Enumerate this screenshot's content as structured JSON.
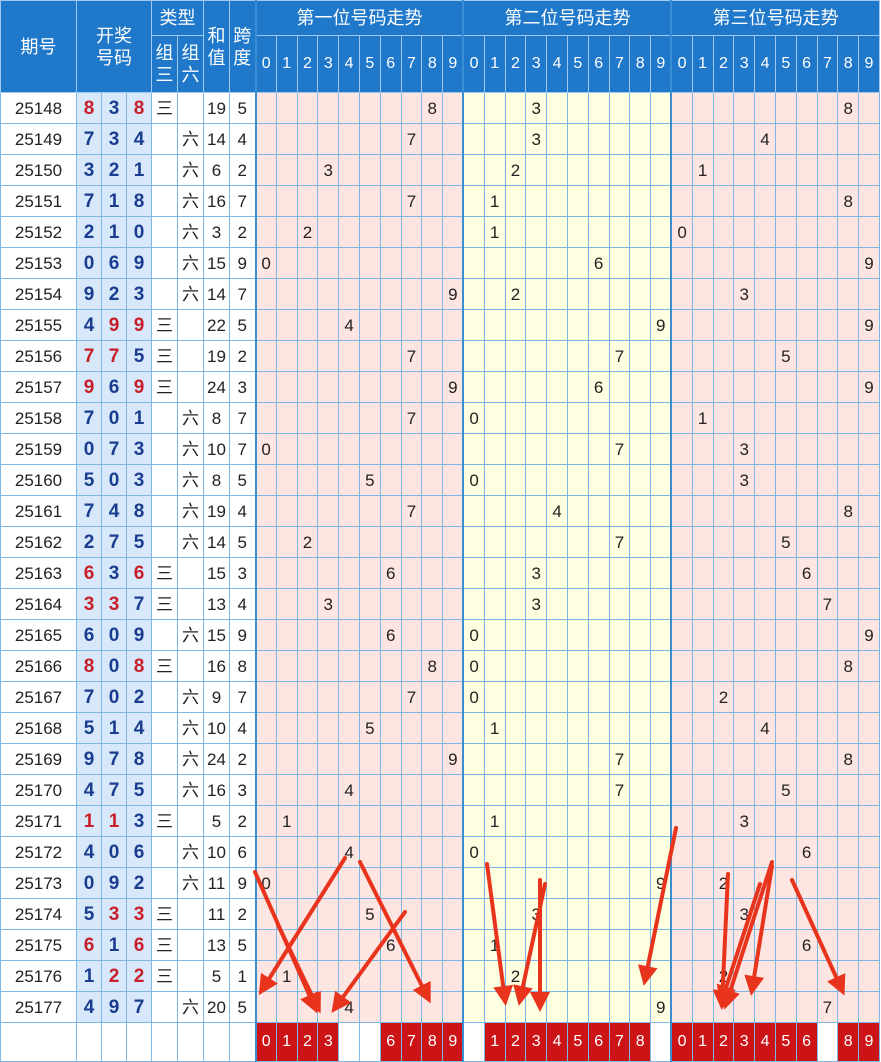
{
  "headers": {
    "issue": "期号",
    "draw_line1": "开奖",
    "draw_line2": "号码",
    "type": "类型",
    "type_z3_line1": "组",
    "type_z3_line2": "三",
    "type_z6_line1": "组",
    "type_z6_line2": "六",
    "sum_line1": "和",
    "sum_line2": "值",
    "span_line1": "跨",
    "span_line2": "度",
    "pos1": "第一位号码走势",
    "pos2": "第二位号码走势",
    "pos3": "第三位号码走势",
    "digits": [
      "0",
      "1",
      "2",
      "3",
      "4",
      "5",
      "6",
      "7",
      "8",
      "9"
    ]
  },
  "colors": {
    "header_bg": "#1f78c9",
    "repeat_digit": "#c8202a",
    "normal_digit": "#1b3d8f",
    "pos1_bg": "#fde5e2",
    "pos2_bg": "#fefee0",
    "pos3_bg": "#fde5e2",
    "pick_bg": "#cc1417",
    "arrow": "#e8341c"
  },
  "rows": [
    {
      "issue": "25148",
      "nums": [
        "8",
        "3",
        "8"
      ],
      "reds": [
        true,
        false,
        true
      ],
      "z3": "三",
      "z6": "",
      "sum": "19",
      "span": "5"
    },
    {
      "issue": "25149",
      "nums": [
        "7",
        "3",
        "4"
      ],
      "reds": [
        false,
        false,
        false
      ],
      "z3": "",
      "z6": "六",
      "sum": "14",
      "span": "4"
    },
    {
      "issue": "25150",
      "nums": [
        "3",
        "2",
        "1"
      ],
      "reds": [
        false,
        false,
        false
      ],
      "z3": "",
      "z6": "六",
      "sum": "6",
      "span": "2"
    },
    {
      "issue": "25151",
      "nums": [
        "7",
        "1",
        "8"
      ],
      "reds": [
        false,
        false,
        false
      ],
      "z3": "",
      "z6": "六",
      "sum": "16",
      "span": "7"
    },
    {
      "issue": "25152",
      "nums": [
        "2",
        "1",
        "0"
      ],
      "reds": [
        false,
        false,
        false
      ],
      "z3": "",
      "z6": "六",
      "sum": "3",
      "span": "2"
    },
    {
      "issue": "25153",
      "nums": [
        "0",
        "6",
        "9"
      ],
      "reds": [
        false,
        false,
        false
      ],
      "z3": "",
      "z6": "六",
      "sum": "15",
      "span": "9"
    },
    {
      "issue": "25154",
      "nums": [
        "9",
        "2",
        "3"
      ],
      "reds": [
        false,
        false,
        false
      ],
      "z3": "",
      "z6": "六",
      "sum": "14",
      "span": "7"
    },
    {
      "issue": "25155",
      "nums": [
        "4",
        "9",
        "9"
      ],
      "reds": [
        false,
        true,
        true
      ],
      "z3": "三",
      "z6": "",
      "sum": "22",
      "span": "5"
    },
    {
      "issue": "25156",
      "nums": [
        "7",
        "7",
        "5"
      ],
      "reds": [
        true,
        true,
        false
      ],
      "z3": "三",
      "z6": "",
      "sum": "19",
      "span": "2"
    },
    {
      "issue": "25157",
      "nums": [
        "9",
        "6",
        "9"
      ],
      "reds": [
        true,
        false,
        true
      ],
      "z3": "三",
      "z6": "",
      "sum": "24",
      "span": "3"
    },
    {
      "issue": "25158",
      "nums": [
        "7",
        "0",
        "1"
      ],
      "reds": [
        false,
        false,
        false
      ],
      "z3": "",
      "z6": "六",
      "sum": "8",
      "span": "7"
    },
    {
      "issue": "25159",
      "nums": [
        "0",
        "7",
        "3"
      ],
      "reds": [
        false,
        false,
        false
      ],
      "z3": "",
      "z6": "六",
      "sum": "10",
      "span": "7"
    },
    {
      "issue": "25160",
      "nums": [
        "5",
        "0",
        "3"
      ],
      "reds": [
        false,
        false,
        false
      ],
      "z3": "",
      "z6": "六",
      "sum": "8",
      "span": "5"
    },
    {
      "issue": "25161",
      "nums": [
        "7",
        "4",
        "8"
      ],
      "reds": [
        false,
        false,
        false
      ],
      "z3": "",
      "z6": "六",
      "sum": "19",
      "span": "4"
    },
    {
      "issue": "25162",
      "nums": [
        "2",
        "7",
        "5"
      ],
      "reds": [
        false,
        false,
        false
      ],
      "z3": "",
      "z6": "六",
      "sum": "14",
      "span": "5"
    },
    {
      "issue": "25163",
      "nums": [
        "6",
        "3",
        "6"
      ],
      "reds": [
        true,
        false,
        true
      ],
      "z3": "三",
      "z6": "",
      "sum": "15",
      "span": "3"
    },
    {
      "issue": "25164",
      "nums": [
        "3",
        "3",
        "7"
      ],
      "reds": [
        true,
        true,
        false
      ],
      "z3": "三",
      "z6": "",
      "sum": "13",
      "span": "4"
    },
    {
      "issue": "25165",
      "nums": [
        "6",
        "0",
        "9"
      ],
      "reds": [
        false,
        false,
        false
      ],
      "z3": "",
      "z6": "六",
      "sum": "15",
      "span": "9"
    },
    {
      "issue": "25166",
      "nums": [
        "8",
        "0",
        "8"
      ],
      "reds": [
        true,
        false,
        true
      ],
      "z3": "三",
      "z6": "",
      "sum": "16",
      "span": "8"
    },
    {
      "issue": "25167",
      "nums": [
        "7",
        "0",
        "2"
      ],
      "reds": [
        false,
        false,
        false
      ],
      "z3": "",
      "z6": "六",
      "sum": "9",
      "span": "7"
    },
    {
      "issue": "25168",
      "nums": [
        "5",
        "1",
        "4"
      ],
      "reds": [
        false,
        false,
        false
      ],
      "z3": "",
      "z6": "六",
      "sum": "10",
      "span": "4"
    },
    {
      "issue": "25169",
      "nums": [
        "9",
        "7",
        "8"
      ],
      "reds": [
        false,
        false,
        false
      ],
      "z3": "",
      "z6": "六",
      "sum": "24",
      "span": "2"
    },
    {
      "issue": "25170",
      "nums": [
        "4",
        "7",
        "5"
      ],
      "reds": [
        false,
        false,
        false
      ],
      "z3": "",
      "z6": "六",
      "sum": "16",
      "span": "3"
    },
    {
      "issue": "25171",
      "nums": [
        "1",
        "1",
        "3"
      ],
      "reds": [
        true,
        true,
        false
      ],
      "z3": "三",
      "z6": "",
      "sum": "5",
      "span": "2"
    },
    {
      "issue": "25172",
      "nums": [
        "4",
        "0",
        "6"
      ],
      "reds": [
        false,
        false,
        false
      ],
      "z3": "",
      "z6": "六",
      "sum": "10",
      "span": "6"
    },
    {
      "issue": "25173",
      "nums": [
        "0",
        "9",
        "2"
      ],
      "reds": [
        false,
        false,
        false
      ],
      "z3": "",
      "z6": "六",
      "sum": "11",
      "span": "9"
    },
    {
      "issue": "25174",
      "nums": [
        "5",
        "3",
        "3"
      ],
      "reds": [
        false,
        true,
        true
      ],
      "z3": "三",
      "z6": "",
      "sum": "11",
      "span": "2"
    },
    {
      "issue": "25175",
      "nums": [
        "6",
        "1",
        "6"
      ],
      "reds": [
        true,
        false,
        true
      ],
      "z3": "三",
      "z6": "",
      "sum": "13",
      "span": "5"
    },
    {
      "issue": "25176",
      "nums": [
        "1",
        "2",
        "2"
      ],
      "reds": [
        false,
        true,
        true
      ],
      "z3": "三",
      "z6": "",
      "sum": "5",
      "span": "1"
    },
    {
      "issue": "25177",
      "nums": [
        "4",
        "9",
        "7"
      ],
      "reds": [
        false,
        false,
        false
      ],
      "z3": "",
      "z6": "六",
      "sum": "20",
      "span": "5"
    }
  ],
  "picks": {
    "pos1": [
      "0",
      "1",
      "2",
      "3",
      "",
      "",
      "6",
      "7",
      "8",
      "9"
    ],
    "pos2": [
      "",
      "1",
      "2",
      "3",
      "4",
      "5",
      "6",
      "7",
      "8",
      ""
    ],
    "pos3": [
      "0",
      "1",
      "2",
      "3",
      "4",
      "5",
      "6",
      "",
      "8",
      "9"
    ]
  }
}
